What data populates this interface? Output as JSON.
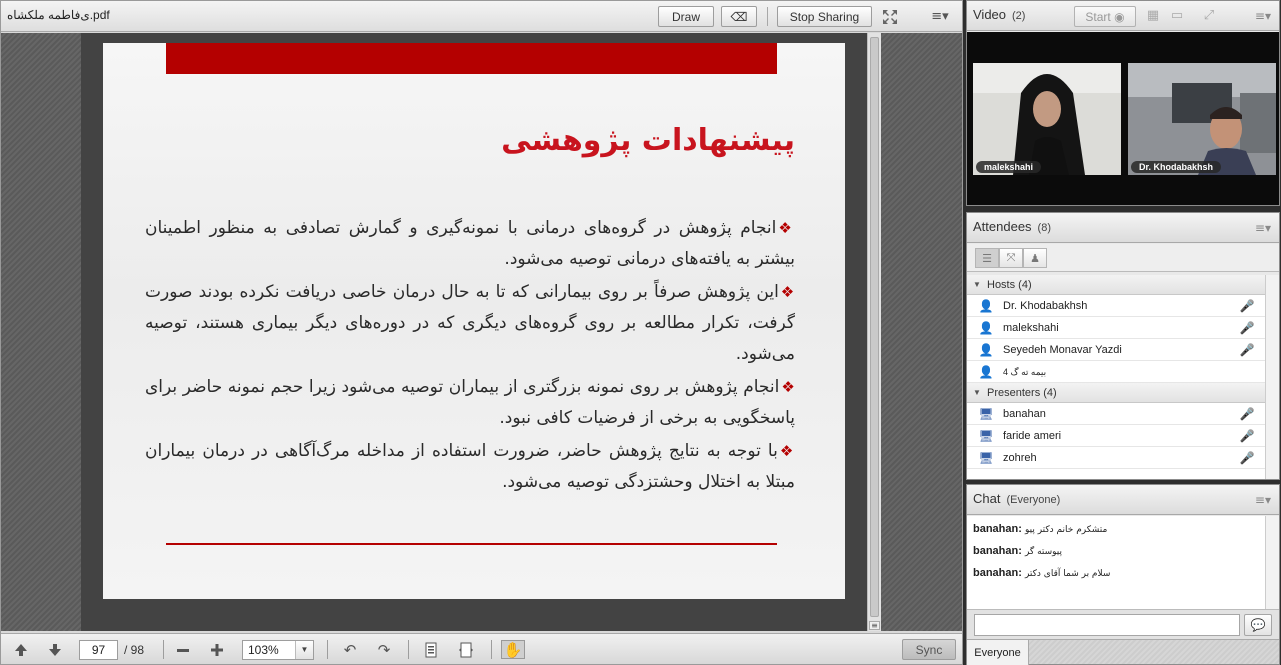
{
  "share": {
    "doc_title": "ی‌فاطمه ملکشاه.pdf",
    "draw_label": "Draw",
    "stop_sharing_label": "Stop Sharing",
    "menu_icon": "≡▾"
  },
  "slide": {
    "title": "پیشنهادات پژوهشی",
    "bullet_glyph": "❖",
    "items": [
      "انجام پژوهش در گروه‌های درمانی با نمونه‌گیری و گمارش تصادفی به منظور اطمینان بیشتر به یافته‌های درمانی توصیه می‌شود.",
      "این پژوهش صرفاً بر روی بیمارانی که تا به حال درمان خاصی دریافت نکرده بودند صورت گرفت، تکرار مطالعه بر روی گروه‌های دیگری که در دوره‌های دیگر بیماری هستند، توصیه می‌شود.",
      "انجام پژوهش بر روی نمونه بزرگتری از بیماران توصیه می‌شود زیرا حجم نمونه حاضر برای پاسخگویی به برخی از فرضیات کافی نبود.",
      "با توجه به نتایج پژوهش حاضر، ضرورت استفاده از مداخله مرگ‌آگاهی در درمان بیماران مبتلا به اختلال وحشتزدگی توصیه می‌شود."
    ]
  },
  "footer": {
    "current_page": "97",
    "total_pages": "/ 98",
    "zoom": "103%",
    "sync_label": "Sync"
  },
  "video": {
    "title": "Video",
    "count": "(2)",
    "start_label": "Start",
    "tiles": [
      {
        "name": "malekshahi"
      },
      {
        "name": "Dr. Khodabakhsh"
      }
    ]
  },
  "attendees": {
    "title": "Attendees",
    "count": "(8)",
    "hosts_label": "Hosts (4)",
    "presenters_label": "Presenters (4)",
    "hosts": [
      {
        "name": "Dr. Khodabakhsh",
        "mic": "on"
      },
      {
        "name": "malekshahi",
        "mic": "off"
      },
      {
        "name": "Seyedeh Monavar Yazdi",
        "mic": "off"
      },
      {
        "name": "4 بیمه ته گ",
        "mic": "none"
      }
    ],
    "presenters": [
      {
        "name": "banahan",
        "mic": "off"
      },
      {
        "name": "faride ameri",
        "mic": "off"
      },
      {
        "name": "zohreh",
        "mic": "on"
      }
    ]
  },
  "chat": {
    "title": "Chat",
    "scope": "(Everyone)",
    "messages": [
      {
        "sender": "banahan:",
        "text": "متشکرم خانم دکتر پیو"
      },
      {
        "sender": "banahan:",
        "text": "پیوسته گر"
      },
      {
        "sender": "banahan:",
        "text": "سلام بر شما آقای دکتر"
      }
    ],
    "input_placeholder": "",
    "tab_label": "Everyone"
  },
  "colors": {
    "slide_accent": "#b40000",
    "title_red": "#c8141e",
    "mic_on": "#2e5ba8",
    "mic_off": "#d61818"
  }
}
